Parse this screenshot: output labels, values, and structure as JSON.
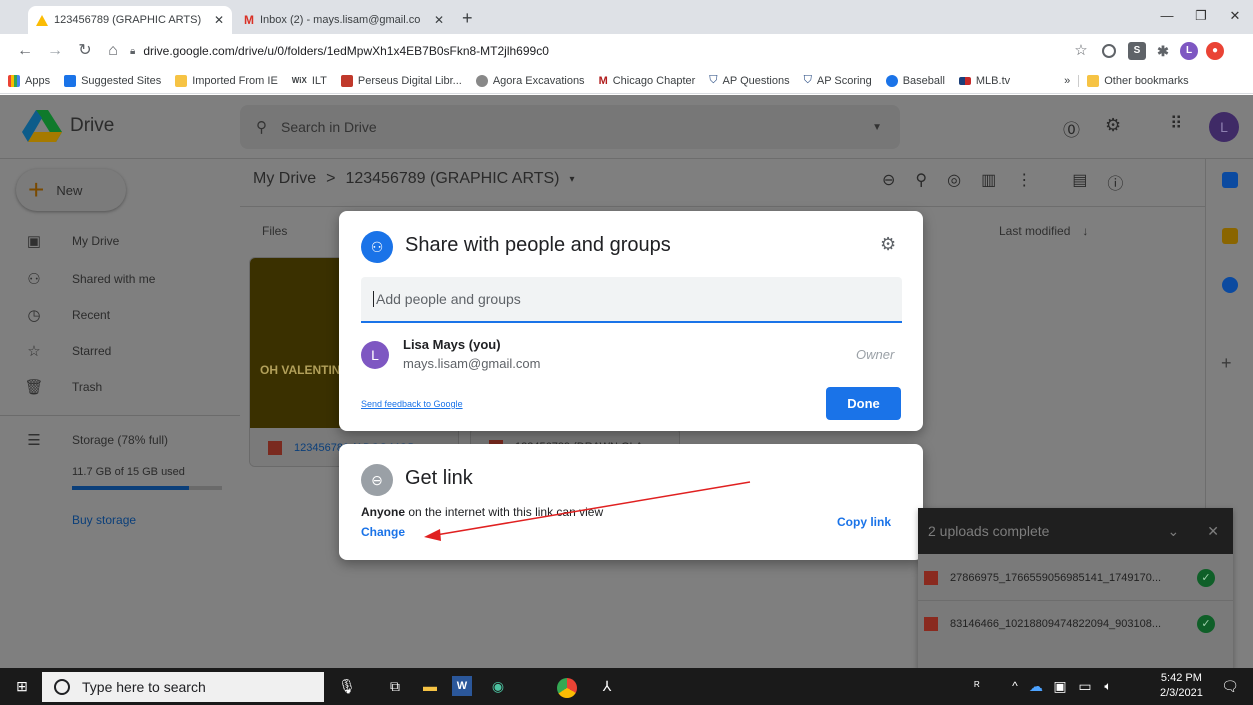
{
  "browser": {
    "tabs": [
      {
        "title": "123456789 (GRAPHIC ARTS) - Go",
        "active": true
      },
      {
        "title": "Inbox (2) - mays.lisam@gmail.co",
        "active": false
      }
    ],
    "new_tab": "+",
    "url": "drive.google.com/drive/u/0/folders/1edMpwXh1x4EB7B0sFkn8-MT2jlh699c0",
    "bookmarks": [
      {
        "label": "Apps",
        "color": "#4285f4"
      },
      {
        "label": "Suggested Sites",
        "color": "#1a73e8"
      },
      {
        "label": "Imported From IE",
        "color": "#f6c344"
      },
      {
        "label": "ILT",
        "color": "#333333"
      },
      {
        "label": "Perseus Digital Libr...",
        "color": "#c0392b"
      },
      {
        "label": "Agora Excavations",
        "color": "#888888"
      },
      {
        "label": "Chicago Chapter",
        "color": "#b11d1d"
      },
      {
        "label": "AP Questions",
        "color": "#1a3f7a"
      },
      {
        "label": "AP Scoring",
        "color": "#1a3f7a"
      },
      {
        "label": "Baseball",
        "color": "#1a73e8"
      },
      {
        "label": "MLB.tv",
        "color": "#c62828"
      }
    ],
    "bookmarks_overflow": "»",
    "other_bookmarks": "Other bookmarks",
    "profile_initial": "L"
  },
  "drive": {
    "app_name": "Drive",
    "search_placeholder": "Search in Drive",
    "new_button": "New",
    "breadcrumb_root": "My Drive",
    "breadcrumb_sep": ">",
    "breadcrumb_current": "123456789 (GRAPHIC ARTS)",
    "files_label": "Files",
    "sort_label": "Last modified",
    "sidebar": [
      {
        "label": "My Drive",
        "icon": "drive-icon"
      },
      {
        "label": "Shared with me",
        "icon": "people-icon"
      },
      {
        "label": "Recent",
        "icon": "clock-icon"
      },
      {
        "label": "Starred",
        "icon": "star-icon"
      },
      {
        "label": "Trash",
        "icon": "trash-icon"
      }
    ],
    "storage_label": "Storage (78% full)",
    "storage_used": "11.7 GB of 15 GB used",
    "storage_fraction": 0.78,
    "buy_storage": "Buy storage",
    "file_cards": [
      "123456789 (ADOS MOD",
      "123456789 (DRAWN GLA"
    ],
    "thumb_text": "OH VALENTIN",
    "avatar_initial": "L"
  },
  "share_dialog": {
    "title": "Share with people and groups",
    "input_placeholder": "Add people and groups",
    "people": [
      {
        "initial": "L",
        "name": "Lisa Mays (you)",
        "email": "mays.lisam@gmail.com",
        "role": "Owner"
      }
    ],
    "feedback_link": "Send feedback to Google",
    "done_button": "Done",
    "accent": "#1a73e8"
  },
  "link_dialog": {
    "title": "Get link",
    "access_bold": "Anyone",
    "access_rest": " on the internet with this link can view",
    "change_link": "Change",
    "copy_link": "Copy link"
  },
  "uploads": {
    "title": "2 uploads complete",
    "items": [
      "27866975_1766559056985141_1749170...",
      "83146466_10218809474822094_903108..."
    ]
  },
  "taskbar": {
    "search_placeholder": "Type here to search",
    "time": "5:42 PM",
    "date": "2/3/2021"
  }
}
